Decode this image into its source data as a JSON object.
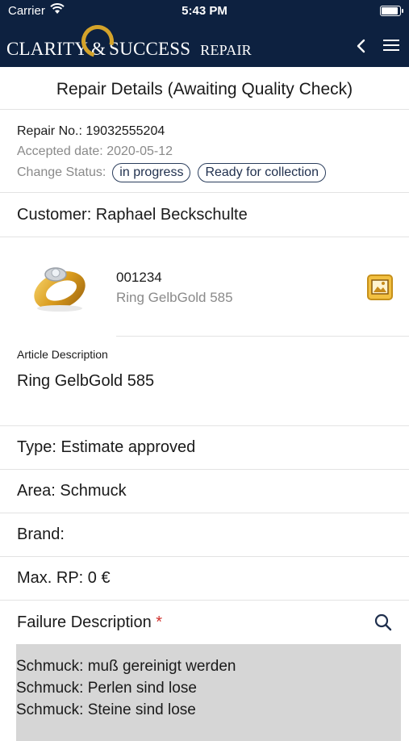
{
  "status_bar": {
    "carrier": "Carrier",
    "time": "5:43 PM",
    "battery_level": 0.9
  },
  "header": {
    "brand_left": "CLARITY",
    "brand_amp": "&",
    "brand_right": "SUCCESS",
    "brand_sub": "REPAIR"
  },
  "page": {
    "title": "Repair Details (Awaiting Quality Check)"
  },
  "repair": {
    "number": "Repair No.: 19032555204",
    "accepted": "Accepted date: 2020-05-12",
    "change_status_label": "Change Status:",
    "status_options": [
      "in progress",
      "Ready for collection"
    ]
  },
  "customer": "Customer: Raphael Beckschulte",
  "article": {
    "code": "001234",
    "name": "Ring GelbGold 585"
  },
  "description": {
    "label": "Article Description",
    "value": "Ring GelbGold 585"
  },
  "details": {
    "type": "Type: Estimate approved",
    "area": "Area: Schmuck",
    "brand": "Brand:",
    "max_rp": "Max. RP: 0 €"
  },
  "failure": {
    "label": "Failure Description",
    "required_mark": "*",
    "lines": [
      "Schmuck: muß gereinigt werden",
      "Schmuck: Perlen sind lose",
      "Schmuck: Steine sind lose"
    ]
  },
  "colors": {
    "navbar": "#0d2140",
    "accent_gold": "#d4a32a",
    "required": "#d0312d"
  }
}
